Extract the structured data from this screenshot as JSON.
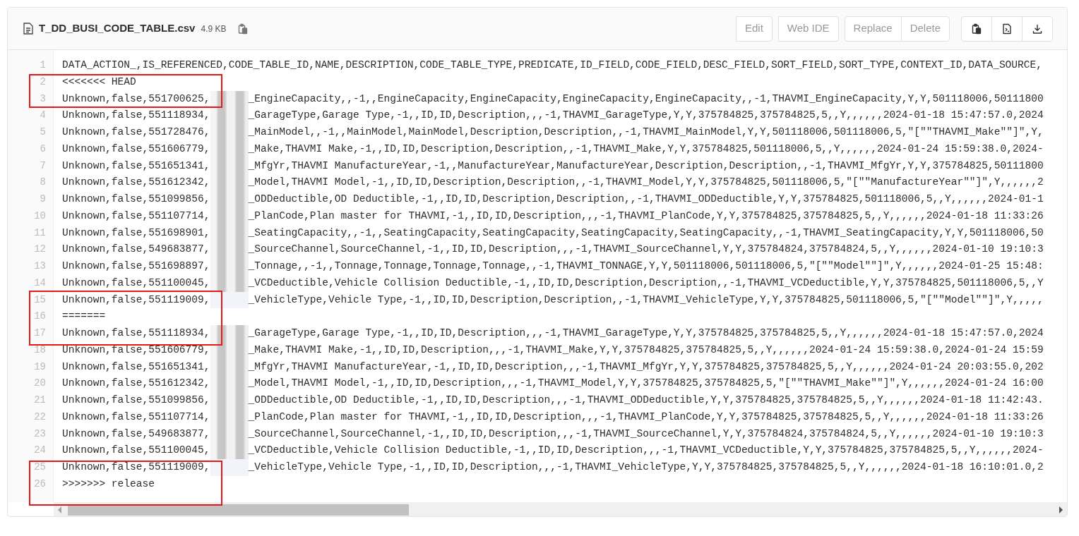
{
  "file": {
    "name": "T_DD_BUSI_CODE_TABLE.csv",
    "size": "4.9 KB"
  },
  "action_groups": [
    [
      {
        "label": "Edit",
        "disabled": true
      }
    ],
    [
      {
        "label": "Web IDE",
        "disabled": true
      }
    ],
    [
      {
        "label": "Replace",
        "disabled": true
      },
      {
        "label": "Delete",
        "disabled": true
      }
    ]
  ],
  "icon_buttons": [
    {
      "kind": "copy"
    },
    {
      "kind": "raw"
    },
    {
      "kind": "download"
    }
  ],
  "lines": [
    {
      "number": "1",
      "kind": "plain",
      "text": "DATA_ACTION_,IS_REFERENCED,CODE_TABLE_ID,NAME,DESCRIPTION,CODE_TABLE_TYPE,PREDICATE,ID_FIELD,CODE_FIELD,DESC_FIELD,SORT_FIELD,SORT_TYPE,CONTEXT_ID,DATA_SOURCE,"
    },
    {
      "number": "2",
      "kind": "plain",
      "text": "<<<<<<< HEAD"
    },
    {
      "number": "3",
      "kind": "blurred",
      "text": "Unknown,false,551700625,",
      "rest": "_EngineCapacity,,-1,,EngineCapacity,EngineCapacity,EngineCapacity,EngineCapacity,,-1,THAVMI_EngineCapacity,Y,Y,501118006,50111800"
    },
    {
      "number": "4",
      "kind": "blurred",
      "text": "Unknown,false,551118934,",
      "rest": "_GarageType,Garage Type,-1,,ID,ID,Description,,,-1,THAVMI_GarageType,Y,Y,375784825,375784825,5,,Y,,,,,,2024-01-18 15:47:57.0,2024"
    },
    {
      "number": "5",
      "kind": "blurred",
      "text": "Unknown,false,551728476,",
      "rest": "_MainModel,,-1,,MainModel,MainModel,Description,Description,,-1,THAVMI_MainModel,Y,Y,501118006,501118006,5,\"[\"\"THAVMI_Make\"\"]\",Y,"
    },
    {
      "number": "6",
      "kind": "blurred",
      "text": "Unknown,false,551606779,",
      "rest": "_Make,THAVMI Make,-1,,ID,ID,Description,Description,,-1,THAVMI_Make,Y,Y,375784825,501118006,5,,Y,,,,,,2024-01-24 15:59:38.0,2024-"
    },
    {
      "number": "7",
      "kind": "blurred",
      "text": "Unknown,false,551651341,",
      "rest": "_MfgYr,THAVMI ManufactureYear,-1,,ManufactureYear,ManufactureYear,Description,Description,,-1,THAVMI_MfgYr,Y,Y,375784825,50111800"
    },
    {
      "number": "8",
      "kind": "blurred",
      "text": "Unknown,false,551612342,",
      "rest": "_Model,THAVMI Model,-1,,ID,ID,Description,Description,,-1,THAVMI_Model,Y,Y,375784825,501118006,5,\"[\"\"ManufactureYear\"\"]\",Y,,,,,,2"
    },
    {
      "number": "9",
      "kind": "blurred",
      "text": "Unknown,false,551099856,",
      "rest": "_ODDeductible,OD Deductible,-1,,ID,ID,Description,Description,,-1,THAVMI_ODDeductible,Y,Y,375784825,501118006,5,,Y,,,,,,2024-01-1"
    },
    {
      "number": "10",
      "kind": "blurred",
      "text": "Unknown,false,551107714,",
      "rest": "_PlanCode,Plan master for THAVMI,-1,,ID,ID,Description,,,-1,THAVMI_PlanCode,Y,Y,375784825,375784825,5,,Y,,,,,,2024-01-18 11:33:26"
    },
    {
      "number": "11",
      "kind": "blurred",
      "text": "Unknown,false,551698901,",
      "rest": "_SeatingCapacity,,-1,,SeatingCapacity,SeatingCapacity,SeatingCapacity,SeatingCapacity,,-1,THAVMI_SeatingCapacity,Y,Y,501118006,50"
    },
    {
      "number": "12",
      "kind": "blurred",
      "text": "Unknown,false,549683877,",
      "rest": "_SourceChannel,SourceChannel,-1,,ID,ID,Description,,,-1,THAVMI_SourceChannel,Y,Y,375784824,375784824,5,,Y,,,,,,2024-01-10 19:10:3"
    },
    {
      "number": "13",
      "kind": "blurred",
      "text": "Unknown,false,551698897,",
      "rest": "_Tonnage,,-1,,Tonnage,Tonnage,Tonnage,Tonnage,,-1,THAVMI_TONNAGE,Y,Y,501118006,501118006,5,\"[\"\"Model\"\"]\",Y,,,,,,2024-01-25 15:48:"
    },
    {
      "number": "14",
      "kind": "blurred",
      "text": "Unknown,false,551100045,",
      "rest": "_VCDeductible,Vehicle Collision Deductible,-1,,ID,ID,Description,Description,,-1,THAVMI_VCDeductible,Y,Y,375784825,501118006,5,,Y"
    },
    {
      "number": "15",
      "kind": "cleared",
      "text": "Unknown,false,551119009,",
      "rest": "_VehicleType,Vehicle Type,-1,,ID,ID,Description,Description,,-1,THAVMI_VehicleType,Y,Y,375784825,501118006,5,\"[\"\"Model\"\"]\",Y,,,,,"
    },
    {
      "number": "16",
      "kind": "plain",
      "text": "======="
    },
    {
      "number": "17",
      "kind": "blurred",
      "text": "Unknown,false,551118934,",
      "rest": "_GarageType,Garage Type,-1,,ID,ID,Description,,,-1,THAVMI_GarageType,Y,Y,375784825,375784825,5,,Y,,,,,,2024-01-18 15:47:57.0,2024"
    },
    {
      "number": "18",
      "kind": "blurred",
      "text": "Unknown,false,551606779,",
      "rest": "_Make,THAVMI Make,-1,,ID,ID,Description,,,-1,THAVMI_Make,Y,Y,375784825,375784825,5,,Y,,,,,,2024-01-24 15:59:38.0,2024-01-24 15:59"
    },
    {
      "number": "19",
      "kind": "blurred",
      "text": "Unknown,false,551651341,",
      "rest": "_MfgYr,THAVMI ManufactureYear,-1,,ID,ID,Description,,,-1,THAVMI_MfgYr,Y,Y,375784825,375784825,5,,Y,,,,,,2024-01-24 20:03:55.0,202"
    },
    {
      "number": "20",
      "kind": "blurred",
      "text": "Unknown,false,551612342,",
      "rest": "_Model,THAVMI Model,-1,,ID,ID,Description,,,-1,THAVMI_Model,Y,Y,375784825,375784825,5,\"[\"\"THAVMI_Make\"\"]\",Y,,,,,,2024-01-24 16:00"
    },
    {
      "number": "21",
      "kind": "blurred",
      "text": "Unknown,false,551099856,",
      "rest": "_ODDeductible,OD Deductible,-1,,ID,ID,Description,,,-1,THAVMI_ODDeductible,Y,Y,375784825,375784825,5,,Y,,,,,,2024-01-18 11:42:43."
    },
    {
      "number": "22",
      "kind": "blurred",
      "text": "Unknown,false,551107714,",
      "rest": "_PlanCode,Plan master for THAVMI,-1,,ID,ID,Description,,,-1,THAVMI_PlanCode,Y,Y,375784825,375784825,5,,Y,,,,,,2024-01-18 11:33:26"
    },
    {
      "number": "23",
      "kind": "blurred",
      "text": "Unknown,false,549683877,",
      "rest": "_SourceChannel,SourceChannel,-1,,ID,ID,Description,,,-1,THAVMI_SourceChannel,Y,Y,375784824,375784824,5,,Y,,,,,,2024-01-10 19:10:3"
    },
    {
      "number": "24",
      "kind": "blurred",
      "text": "Unknown,false,551100045,",
      "rest": "_VCDeductible,Vehicle Collision Deductible,-1,,ID,ID,Description,,,-1,THAVMI_VCDeductible,Y,Y,375784825,375784825,5,,Y,,,,,,2024-"
    },
    {
      "number": "25",
      "kind": "cleared",
      "text": "Unknown,false,551119009,",
      "rest": "_VehicleType,Vehicle Type,-1,,ID,ID,Description,,,-1,THAVMI_VehicleType,Y,Y,375784825,375784825,5,,Y,,,,,,2024-01-18 16:10:01.0,2"
    },
    {
      "number": "26",
      "kind": "plain",
      "text": ">>>>>>> release"
    }
  ],
  "annotations": [
    {
      "kind": "rectangle"
    },
    {
      "kind": "rectangle"
    },
    {
      "kind": "rectangle"
    }
  ]
}
